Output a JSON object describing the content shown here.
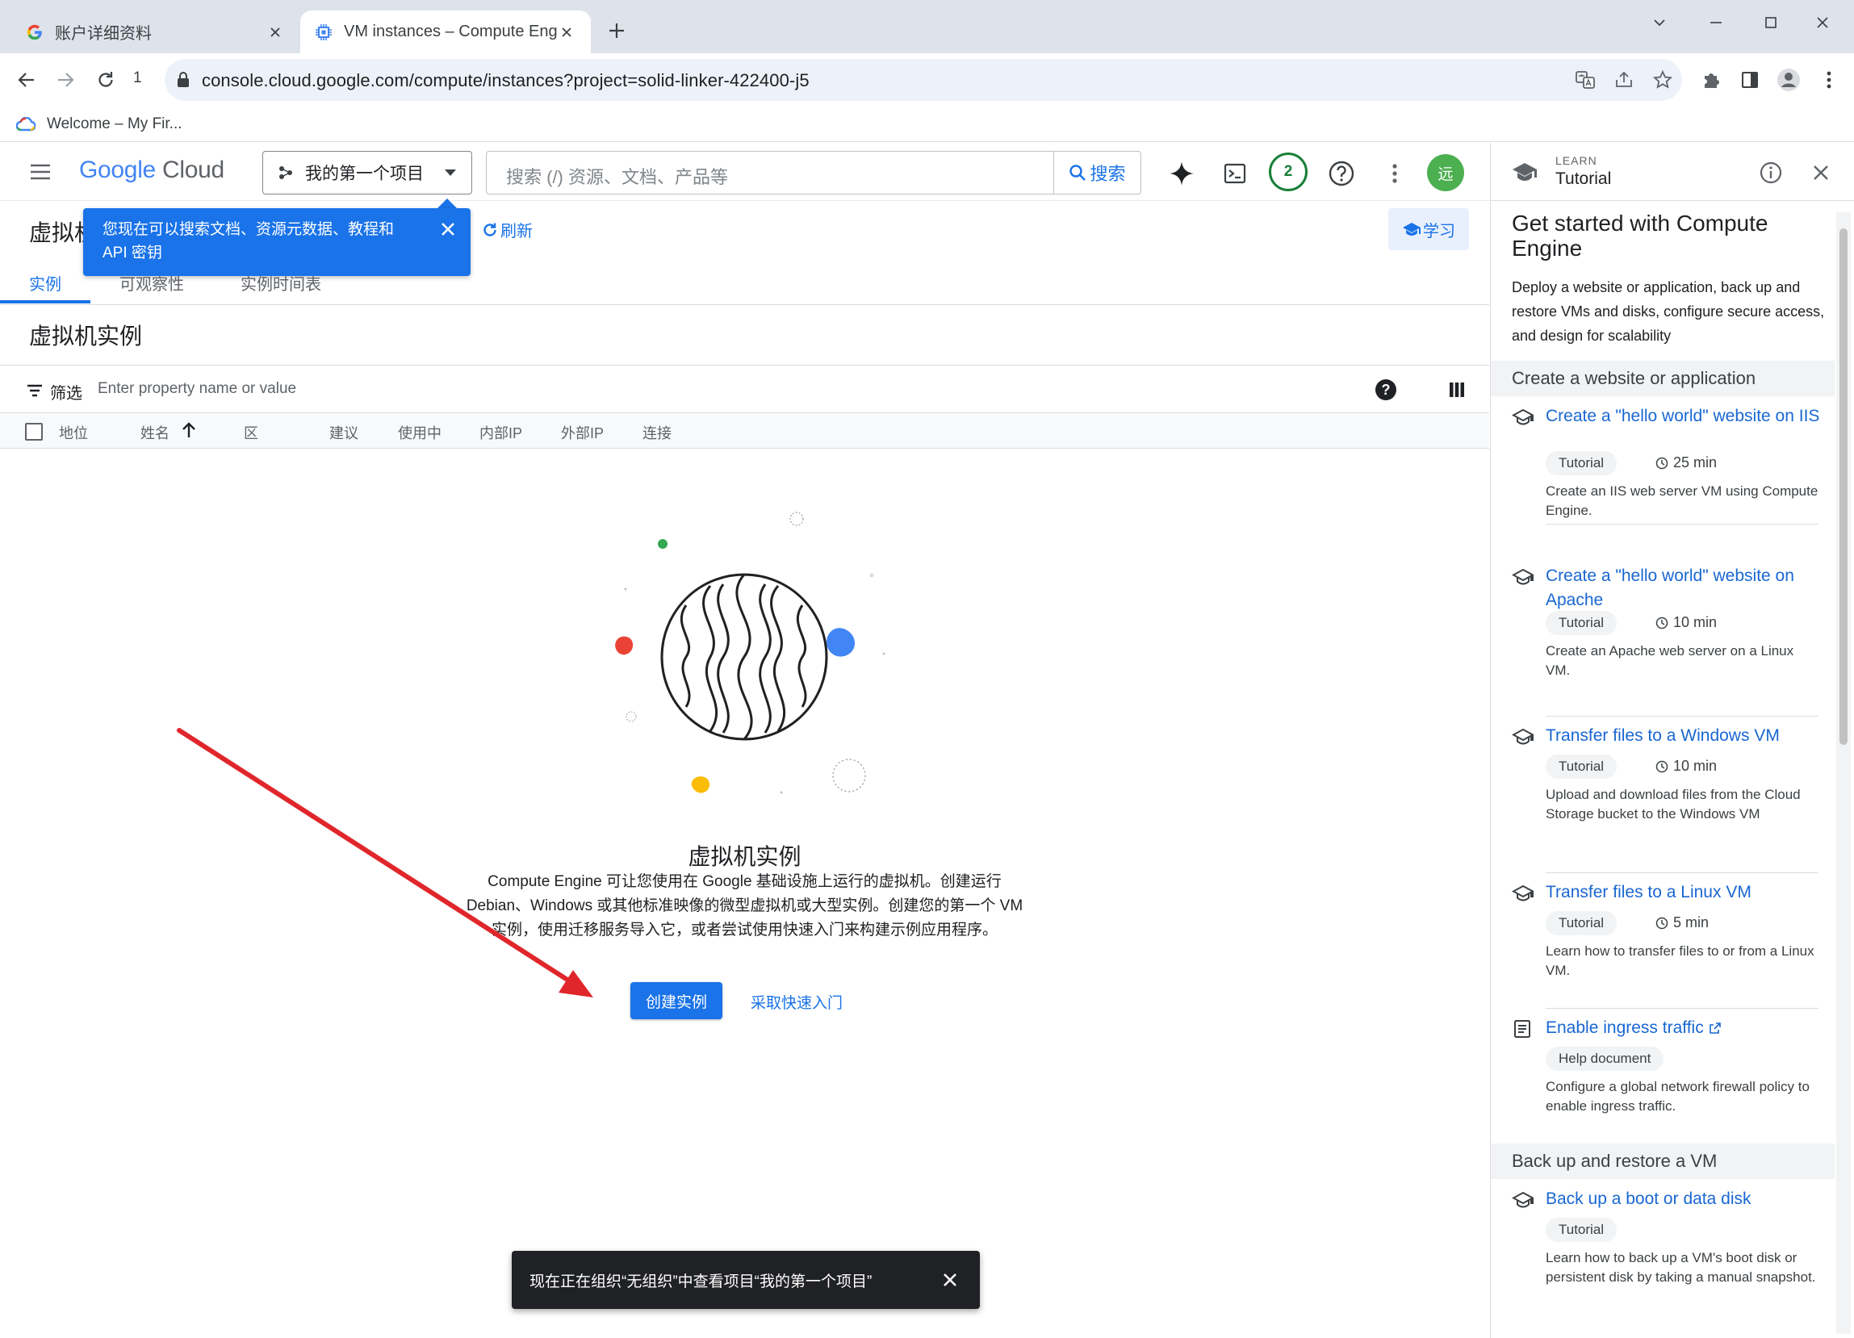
{
  "browser": {
    "tabs": [
      {
        "title": "账户详细资料",
        "icon": "google-g-icon",
        "active": false
      },
      {
        "title": "VM instances – Compute Engi",
        "icon": "compute-chip-icon",
        "active": true
      }
    ],
    "url": "console.cloud.google.com/compute/instances?project=solid-linker-422400-j5",
    "reload_badge": "1",
    "bookmarks": [
      {
        "label": "Welcome – My Fir..."
      }
    ]
  },
  "header": {
    "logo_google": "Google",
    "logo_cloud": "Cloud",
    "project": "我的第一个项目",
    "search_placeholder": "搜索 (/) 资源、文档、产品等",
    "search_button": "搜索",
    "notification_count": "2",
    "avatar_initial": "远"
  },
  "page": {
    "title": "虚拟机",
    "tooltip": "您现在可以搜索文档、资源元数据、教程和 API 密钥",
    "refresh": "刷新",
    "learn": "学习",
    "tabs": [
      "实例",
      "可观察性",
      "实例时间表"
    ],
    "section_title": "虚拟机实例",
    "filter_label": "筛选",
    "filter_placeholder": "Enter property name or value",
    "help_glyph": "?",
    "columns": [
      "地位",
      "姓名",
      "区",
      "建议",
      "使用中",
      "内部IP",
      "外部IP",
      "连接"
    ]
  },
  "empty_state": {
    "title": "虚拟机实例",
    "description": "Compute Engine 可让您使用在 Google 基础设施上运行的虚拟机。创建运行 Debian、Windows 或其他标准映像的微型虚拟机或大型实例。创建您的第一个 VM 实例，使用迁移服务导入它，或者尝试使用快速入门来构建示例应用程序。",
    "create_button": "创建实例",
    "quickstart_link": "采取快速入门"
  },
  "snackbar": {
    "text": "现在正在组织“无组织”中查看项目“我的第一个项目”"
  },
  "panel": {
    "kicker": "LEARN",
    "title": "Tutorial",
    "intro_title": "Get started with Compute Engine",
    "intro_desc": "Deploy a website or application, back up and restore VMs and disks, configure secure access, and design for scalability",
    "sections": [
      {
        "title": "Create a website or application",
        "items": [
          {
            "title": "Create a \"hello world\" website on IIS",
            "type": "Tutorial",
            "duration": "25 min",
            "desc": "Create an IIS web server VM using Compute Engine."
          },
          {
            "title": "Create a \"hello world\" website on Apache",
            "type": "Tutorial",
            "duration": "10 min",
            "desc": "Create an Apache web server on a Linux VM."
          },
          {
            "title": "Transfer files to a Windows VM",
            "type": "Tutorial",
            "duration": "10 min",
            "desc": "Upload and download files from the Cloud Storage bucket to the Windows VM"
          },
          {
            "title": "Transfer files to a Linux VM",
            "type": "Tutorial",
            "duration": "5 min",
            "desc": "Learn how to transfer files to or from a Linux VM."
          },
          {
            "title": "Enable ingress traffic",
            "type": "Help document",
            "duration": "",
            "desc": "Configure a global network firewall policy to enable ingress traffic."
          }
        ]
      },
      {
        "title": "Back up and restore a VM",
        "items": [
          {
            "title": "Back up a boot or data disk",
            "type": "Tutorial",
            "duration": "",
            "desc": "Learn how to back up a VM's boot disk or persistent disk by taking a manual snapshot."
          }
        ]
      }
    ]
  },
  "colors": {
    "accent": "#1a73e8",
    "tab_strip": "#dee3eb",
    "omnibox": "#edf2fa",
    "annotation_arrow": "#e0262b",
    "snackbar": "#202124"
  }
}
